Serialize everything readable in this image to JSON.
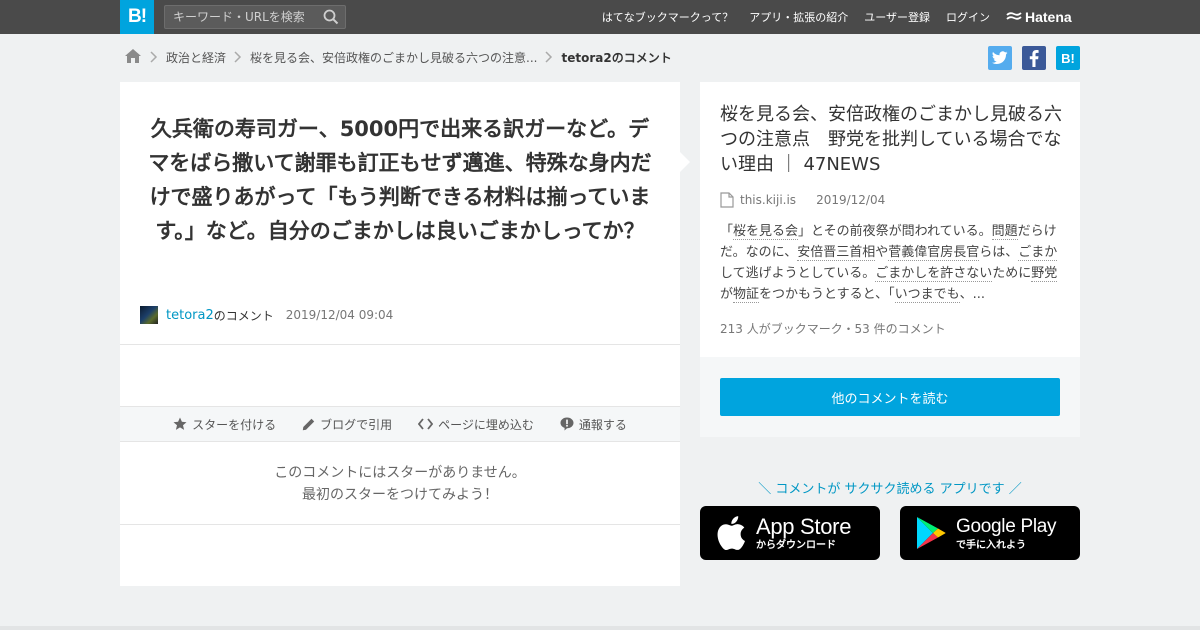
{
  "header": {
    "logo": "B!",
    "search_placeholder": "キーワード・URLを検索",
    "nav": [
      "はてなブックマークって？",
      "アプリ・拡張の紹介",
      "ユーザー登録",
      "ログイン"
    ],
    "brand": "Hatena"
  },
  "breadcrumb": {
    "items": [
      "政治と経済",
      "桜を見る会、安倍政権のごまかし見破る六つの注意...",
      "tetora2のコメント"
    ]
  },
  "share": {
    "twitter": "twitter-icon",
    "facebook": "facebook-icon",
    "hatena": "B!"
  },
  "comment": {
    "text": "久兵衛の寿司ガー、5000円で出来る訳ガーなど。デマをばら撒いて謝罪も訂正もせず邁進、特殊な身内だけで盛りあがって「もう判断できる材料は揃っています。」など。自分のごまかしは良いごまかしってか？",
    "user": "tetora2",
    "user_suffix": "のコメント",
    "date": "2019/12/04 09:04"
  },
  "actions": {
    "star": "スターを付ける",
    "blog": "ブログで引用",
    "embed": "ページに埋め込む",
    "report": "通報する"
  },
  "stars": {
    "line1": "このコメントにはスターがありません。",
    "line2": "最初のスターをつけてみよう！"
  },
  "entry": {
    "title": "桜を見る会、安倍政権のごまかし見破る六つの注意点　野党を批判している場合でない理由 ｜ 47NEWS",
    "domain": "this.kiji.is",
    "date": "2019/12/04",
    "summary": {
      "s1": "「",
      "k1": "桜を見る会",
      "s2": "」とその前夜祭が問われている。",
      "k2": "問題",
      "s3": "だらけだ。なのに、",
      "k3": "安倍晋三首相",
      "s4": "や",
      "k4": "菅義偉官房長官",
      "s5": "らは、",
      "k5": "ごまか",
      "s6": "して逃げようとしている。",
      "k6": "ごまかしを許さない",
      "s7": "ために",
      "k7": "野党",
      "s8": "が",
      "k8": "物証",
      "s9": "をつかもうとすると、「",
      "k9": "いつまでも",
      "s10": "、..."
    },
    "count": "213 人がブックマーク・53 件のコメント",
    "more_button": "他のコメントを読む"
  },
  "promo": {
    "text": "＼ コメントが サクサク読める アプリです ／",
    "apple_big": "App Store",
    "apple_small": "からダウンロード",
    "google_big": "Google Play",
    "google_small": "で手に入れよう"
  },
  "colors": {
    "accent": "#00a4de",
    "header": "#4a4a4a",
    "twitter": "#55acee",
    "facebook": "#3b5998"
  }
}
